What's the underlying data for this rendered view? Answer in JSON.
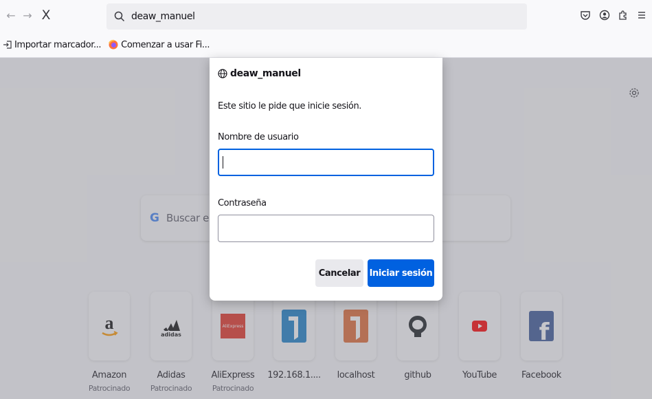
{
  "toolbar": {
    "back_icon": "arrow-left-icon",
    "forward_icon": "arrow-right-icon",
    "stop_label": "X",
    "url": "deaw_manuel",
    "right_icons": [
      "pocket-icon",
      "account-icon",
      "extensions-icon",
      "menu-icon"
    ]
  },
  "bookmarks": [
    {
      "label": "Importar marcador...",
      "icon": "import-icon"
    },
    {
      "label": "Comenzar a usar Fi...",
      "icon": "firefox-icon"
    }
  ],
  "newtab": {
    "search_placeholder": "Buscar en",
    "tiles": [
      {
        "name": "Amazon",
        "sub": "Patrocinado",
        "icon": "amazon-logo"
      },
      {
        "name": "Adidas",
        "sub": "Patrocinado",
        "icon": "adidas-logo"
      },
      {
        "name": "AliExpress",
        "sub": "Patrocinado",
        "icon": "aliexpress-logo",
        "logo_text": "AliExpress"
      },
      {
        "name": "192.168.1....",
        "sub": "",
        "icon": "number-one-logo"
      },
      {
        "name": "localhost",
        "sub": "",
        "icon": "localhost-logo"
      },
      {
        "name": "github",
        "sub": "",
        "icon": "github-logo"
      },
      {
        "name": "YouTube",
        "sub": "",
        "icon": "youtube-logo"
      },
      {
        "name": "Facebook",
        "sub": "",
        "icon": "facebook-logo"
      }
    ]
  },
  "dialog": {
    "host": "deaw_manuel",
    "message": "Este sitio le pide que inicie sesión.",
    "username_label": "Nombre de usuario",
    "username_value": "",
    "password_label": "Contraseña",
    "password_value": "",
    "cancel_label": "Cancelar",
    "login_label": "Iniciar sesión"
  },
  "colors": {
    "accent": "#0061e0",
    "amazon_orange": "#ff9900",
    "aliexpress_red": "#e43225",
    "one_blue": "#1a80c8",
    "localhost_orange": "#e06b36",
    "youtube_red": "#ff0000",
    "facebook_blue": "#3b5998"
  }
}
